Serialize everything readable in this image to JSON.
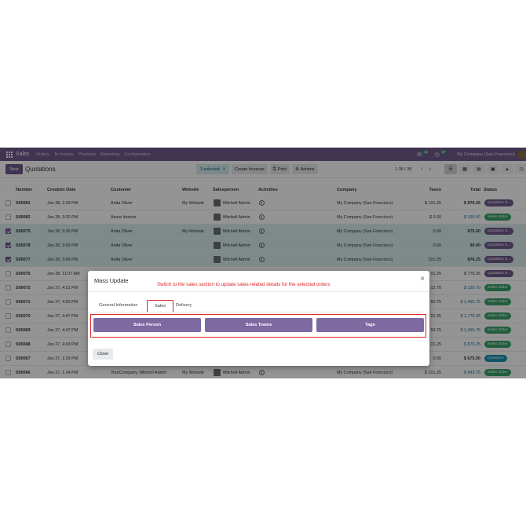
{
  "navbar": {
    "app_name": "Sales",
    "menu": [
      "Orders",
      "To Invoice",
      "Products",
      "Reporting",
      "Configuration"
    ],
    "chat_count": "18",
    "activity_count": "27",
    "company": "My Company (San Francisco)"
  },
  "control_panel": {
    "new_label": "New",
    "breadcrumb": "Quotations",
    "selected_label": "3 selected",
    "create_invoices_label": "Create Invoices",
    "print_label": "Print",
    "actions_label": "Actions",
    "pager": "1-38 / 38"
  },
  "table": {
    "headers": {
      "number": "Number",
      "creation_date": "Creation Date",
      "customer": "Customer",
      "website": "Website",
      "salesperson": "Salesperson",
      "activities": "Activities",
      "company": "Company",
      "taxes": "Taxes",
      "total": "Total",
      "status": "Status"
    },
    "rows": [
      {
        "number": "S00081",
        "date": "Jan 28, 3:29 PM",
        "customer": "Anita Oliver",
        "website": "My Website",
        "salesperson": "Mitchell Admin",
        "company": "My Company (San Francisco)",
        "taxes": "$ 101.25",
        "total": "$ 876.25",
        "status": "Quotation S..."
      },
      {
        "number": "S00082",
        "date": "Jan 28, 3:32 PM",
        "customer": "Azure Interior",
        "website": "",
        "salesperson": "Mitchell Admin",
        "company": "My Company (San Francisco)",
        "taxes": "$ 0.00",
        "total": "$ 190.00",
        "status": "Sales Order"
      },
      {
        "number": "S00079",
        "date": "Jan 28, 3:26 PM",
        "customer": "Anita Oliver",
        "website": "My Website",
        "salesperson": "Mitchell Admin",
        "company": "My Company (San Francisco)",
        "taxes": "0.00",
        "total": "675.00",
        "status": "Quotation S..."
      },
      {
        "number": "S00078",
        "date": "Jan 28, 3:09 PM",
        "customer": "Anita Oliver",
        "website": "",
        "salesperson": "Mitchell Admin",
        "company": "My Company (San Francisco)",
        "taxes": "0.00",
        "total": "90.00",
        "status": "Quotation S..."
      },
      {
        "number": "S00077",
        "date": "Jan 28, 3:06 PM",
        "customer": "Anita Oliver",
        "website": "",
        "salesperson": "Mitchell Admin",
        "company": "My Company (San Francisco)",
        "taxes": "101.25",
        "total": "876.25",
        "status": "Quotation S..."
      },
      {
        "number": "S00075",
        "date": "Jan 28, 11:07 AM",
        "customer": "",
        "website": "",
        "salesperson": "",
        "company": "",
        "taxes": "01.25",
        "total": "$ 776.25",
        "status": "Quotation S..."
      },
      {
        "number": "S00072",
        "date": "Jan 27, 4:51 PM",
        "customer": "",
        "website": "",
        "salesperson": "",
        "company": "",
        "taxes": "12.70",
        "total": "$ 120.70",
        "status": "Sales Order"
      },
      {
        "number": "S00071",
        "date": "Jan 27, 4:50 PM",
        "customer": "",
        "website": "",
        "salesperson": "",
        "company": "",
        "taxes": "60.75",
        "total": "$ 1,465.75",
        "status": "Sales Order"
      },
      {
        "number": "S00070",
        "date": "Jan 27, 4:47 PM",
        "customer": "",
        "website": "",
        "salesperson": "",
        "company": "",
        "taxes": "01.25",
        "total": "$ 1,776.25",
        "status": "Sales Order"
      },
      {
        "number": "S00069",
        "date": "Jan 27, 4:47 PM",
        "customer": "",
        "website": "",
        "salesperson": "",
        "company": "",
        "taxes": "60.75",
        "total": "$ 1,465.75",
        "status": "Sales Order"
      },
      {
        "number": "S00068",
        "date": "Jan 27, 4:43 PM",
        "customer": "",
        "website": "",
        "salesperson": "",
        "company": "",
        "taxes": "01.25",
        "total": "$ 876.25",
        "status": "Sales Order"
      },
      {
        "number": "S00067",
        "date": "Jan 27, 1:26 PM",
        "customer": "",
        "website": "",
        "salesperson": "",
        "company": "",
        "taxes": "0.00",
        "total": "$ 675.00",
        "status": "Quotation"
      },
      {
        "number": "S00066",
        "date": "Jan 27, 1:24 PM",
        "customer": "YourCompany, Mitchell Admin",
        "website": "My Website",
        "salesperson": "Mitchell Admin",
        "company": "My Company (San Francisco)",
        "taxes": "$ 101.25",
        "total": "$ 843.75",
        "status": "Sales Order"
      }
    ]
  },
  "modal": {
    "title": "Mass Update",
    "annotation": "Switch to the sales section to update sales-related details for the selected orders",
    "tabs": [
      "General Information",
      "Sales",
      "Delivery"
    ],
    "buttons": [
      "Sales Person",
      "Sales Teams",
      "Tags"
    ],
    "close_label": "Close"
  },
  "colors": {
    "brand": "#6f5a8c",
    "button": "#7e69a1",
    "highlight": "#e02424",
    "sales_order": "#3aa36a"
  }
}
